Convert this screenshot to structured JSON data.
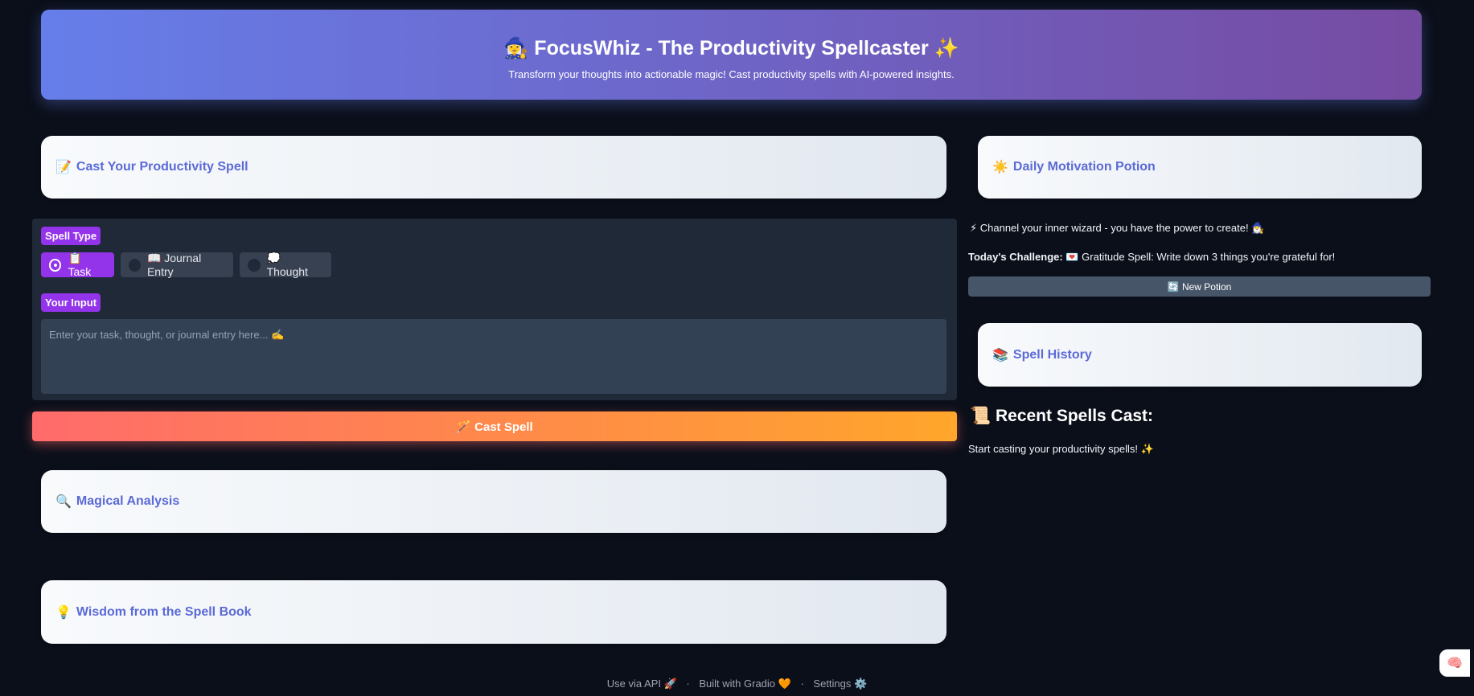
{
  "header": {
    "title": "🧙‍♀️ FocusWhiz - The Productivity Spellcaster ✨",
    "subtitle": "Transform your thoughts into actionable magic! Cast productivity spells with AI-powered insights."
  },
  "cast_card": {
    "icon": "📝",
    "label": "Cast Your Productivity Spell"
  },
  "spell_type": {
    "label": "Spell Type",
    "options": [
      {
        "label": "📋 Task",
        "selected": true
      },
      {
        "label": "📖 Journal Entry",
        "selected": false
      },
      {
        "label": "💭 Thought",
        "selected": false
      }
    ]
  },
  "input": {
    "label": "Your Input",
    "placeholder": "Enter your task, thought, or journal entry here... ✍️",
    "value": ""
  },
  "cast_button": "🪄 Cast Spell",
  "analysis_card": {
    "icon": "🔍",
    "label": "Magical Analysis"
  },
  "wisdom_card": {
    "icon": "💡",
    "label": "Wisdom from the Spell Book"
  },
  "motivation_card": {
    "icon": "☀️",
    "label": "Daily Motivation Potion"
  },
  "motivation": {
    "message": "⚡ Channel your inner wizard - you have the power to create! 🧙‍♂️",
    "challenge_label": "Today's Challenge:",
    "challenge_text": "💌 Gratitude Spell: Write down 3 things you're grateful for!",
    "button": "🔄 New Potion"
  },
  "history_card": {
    "icon": "📚",
    "label": "Spell History"
  },
  "recent": {
    "heading": "📜 Recent Spells Cast:",
    "empty": "Start casting your productivity spells! ✨"
  },
  "footer": {
    "api": "Use via API 🚀",
    "sep1": "·",
    "gradio": "Built with Gradio 🧡",
    "sep2": "·",
    "settings": "Settings ⚙️"
  },
  "float_icon": "🧠",
  "colors": {
    "background": "#0b0f1a",
    "accent_purple": "#9333ea",
    "card_text": "#5b6ad6",
    "cast_gradient_start": "#ff6b6b",
    "cast_gradient_end": "#ffa62b"
  }
}
